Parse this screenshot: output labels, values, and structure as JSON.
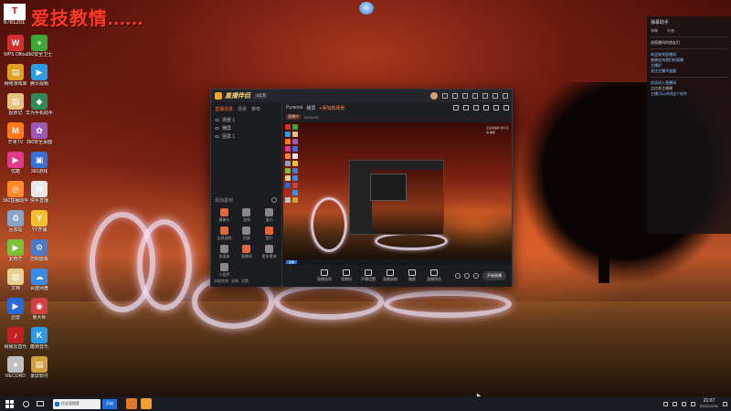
{
  "banner": {
    "logo_text": "T",
    "id_text": "8781201",
    "headline": "爱技教情......"
  },
  "desktop_icons": [
    {
      "label": "WPS Office",
      "color": "#d03030",
      "glyph": "W"
    },
    {
      "label": "360安全卫士",
      "color": "#3aa832",
      "glyph": "+"
    },
    {
      "label": "网络游戏库",
      "color": "#e0a020",
      "glyph": "▤"
    },
    {
      "label": "腾讯视频",
      "color": "#2d9be0",
      "glyph": "▶"
    },
    {
      "label": "捉妖记",
      "color": "#e8c080",
      "glyph": "▤"
    },
    {
      "label": "华为手机助手",
      "color": "#2e8b57",
      "glyph": "◆"
    },
    {
      "label": "芒果TV",
      "color": "#ff7a1a",
      "glyph": "M"
    },
    {
      "label": "360安全桌面",
      "color": "#9b59b6",
      "glyph": "✿"
    },
    {
      "label": "优酷",
      "color": "#e03a8a",
      "glyph": "▶"
    },
    {
      "label": "360游戏",
      "color": "#3a6fd8",
      "glyph": "▣"
    },
    {
      "label": "360直播助手",
      "color": "#ff8a2a",
      "glyph": "◎"
    },
    {
      "label": "快手直播",
      "color": "#e8e8e8",
      "glyph": "N"
    },
    {
      "label": "回收站",
      "color": "#8aa4c8",
      "glyph": "♻"
    },
    {
      "label": "YY开播",
      "color": "#f0c030",
      "glyph": "Y"
    },
    {
      "label": "爱奇艺",
      "color": "#7bbf3a",
      "glyph": "▶"
    },
    {
      "label": "控制面板",
      "color": "#4a7ac8",
      "glyph": "⚙"
    },
    {
      "label": "文档",
      "color": "#e8d090",
      "glyph": "▤"
    },
    {
      "label": "百度网盘",
      "color": "#3a8ae8",
      "glyph": "☁"
    },
    {
      "label": "迅雷",
      "color": "#2a6ad8",
      "glyph": "▶"
    },
    {
      "label": "鲁大师",
      "color": "#d04040",
      "glyph": "◉"
    },
    {
      "label": "网易云音乐",
      "color": "#c02020",
      "glyph": "♪"
    },
    {
      "label": "酷狗音乐",
      "color": "#2a9ae8",
      "glyph": "K"
    },
    {
      "label": "RECORD",
      "color": "#c0c0c0",
      "glyph": "●"
    },
    {
      "label": "录屏软件",
      "color": "#d0a040",
      "glyph": "▤"
    }
  ],
  "app": {
    "name": "直播伴侣",
    "version": "v1.6",
    "left_tabs": [
      "直播场景",
      "场景",
      "推荐"
    ],
    "scenes": [
      "场景 1",
      "横屏",
      "竖屏 1"
    ],
    "add_source_label": "添加素材",
    "tools": [
      {
        "label": "摄像头",
        "color": "#e8643a"
      },
      {
        "label": "游戏",
        "color": "#888888"
      },
      {
        "label": "窗口",
        "color": "#888888"
      },
      {
        "label": "全屏录制",
        "color": "#e8643a"
      },
      {
        "label": "投屏",
        "color": "#888888"
      },
      {
        "label": "图片",
        "color": "#e8643a"
      },
      {
        "label": "多媒体",
        "color": "#888888"
      },
      {
        "label": "直播间",
        "color": "#e8643a"
      },
      {
        "label": "更多素材",
        "color": "#888888"
      },
      {
        "label": "小程序",
        "color": "#888888"
      }
    ],
    "left_bottom": [
      "本地视频",
      "录制",
      "设置"
    ],
    "main_tabs": [
      "Pyramid",
      "横屏",
      "+添加新场景"
    ],
    "main_subbar_chip": "直播中",
    "main_subbar_text": "00:00:00",
    "preview_side_text": "正在直播中 观众互动 弹幕",
    "status_chip": "直播",
    "bottom_tools": [
      "直播画质",
      "直播间",
      "开播设置",
      "直播录制",
      "美颜",
      "直播预览"
    ],
    "live_button": "开始直播"
  },
  "chat": {
    "header": "弹幕助手",
    "tabs": [
      "弹幕",
      "礼物"
    ],
    "messages": [
      {
        "text": "进直播间的朋友们",
        "style": "white"
      },
      {
        "text": "欢迎来到直播间",
        "style": "blue"
      },
      {
        "text": "感谢支持我们的直播",
        "style": "blue"
      },
      {
        "text": "主播好",
        "style": "blue"
      },
      {
        "text": "关注主播不迷路",
        "style": "blue"
      },
      {
        "text": "欢迎进入直播间",
        "style": "blue"
      },
      {
        "text": "点点关注谢谢",
        "style": "white"
      },
      {
        "text": "主播可以讲讲这个软件",
        "style": "blue"
      }
    ]
  },
  "taskbar": {
    "search_text": "在这里搜索",
    "blue_button": "开始",
    "time": "21:07",
    "date": "2022/12/31"
  }
}
